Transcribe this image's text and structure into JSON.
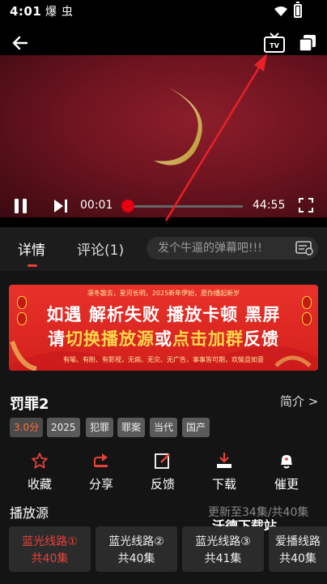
{
  "status_bar": {
    "time": "4:01",
    "app_icons": [
      "爆",
      "虫"
    ]
  },
  "player": {
    "current_time": "00:01",
    "duration": "44:55",
    "progress": 0.0004,
    "icons": {
      "back": "arrow-left-icon",
      "cast": "tv-icon",
      "pip": "copy-icon",
      "play": "pause-icon",
      "next": "next-icon",
      "fullscreen": "fullscreen-icon"
    }
  },
  "tabs": [
    {
      "label": "详情",
      "active": true
    },
    {
      "label": "评论(1)",
      "active": false
    }
  ],
  "danmaku": {
    "placeholder": "发个牛逼的弹幕吧!!!"
  },
  "banner": {
    "top_text": "凛冬散去，星河长明，2025新年伊始，愿你播起新岁",
    "line1": "如遇 解析失败 播放卡顿 黑屏",
    "line2_a": "请",
    "line2_b": "切换播放源",
    "line2_c": "或",
    "line2_d": "点击加群",
    "line2_e": "反馈",
    "bottom_text": "有喻、有盼、有影视，无病、无灾、无广告，事事皆可期，欢愉且如意"
  },
  "show": {
    "title": "罚罪2",
    "intro_label": "简介 >",
    "tags": [
      "3.0分",
      "2025",
      "犯罪",
      "罪案",
      "当代",
      "国产"
    ]
  },
  "actions": [
    {
      "label": "收藏",
      "icon": "star-icon"
    },
    {
      "label": "分享",
      "icon": "share-icon"
    },
    {
      "label": "反馈",
      "icon": "edit-icon"
    },
    {
      "label": "下载",
      "icon": "download-icon"
    },
    {
      "label": "催更",
      "icon": "bell-icon"
    }
  ],
  "sources": {
    "title": "播放源",
    "update": "更新至34集/共40集",
    "watermark": "沃德下载站",
    "lines": [
      {
        "name": "蓝光线路①",
        "count": "共40集",
        "active": true
      },
      {
        "name": "蓝光线路②",
        "count": "共40集",
        "active": false
      },
      {
        "name": "蓝光线路③",
        "count": "共41集",
        "active": false
      },
      {
        "name": "爱播线路",
        "count": "共40集",
        "active": false
      }
    ]
  },
  "colors": {
    "accent": "#e8413a",
    "progress": "#e60012",
    "banner": "#d4201c"
  }
}
